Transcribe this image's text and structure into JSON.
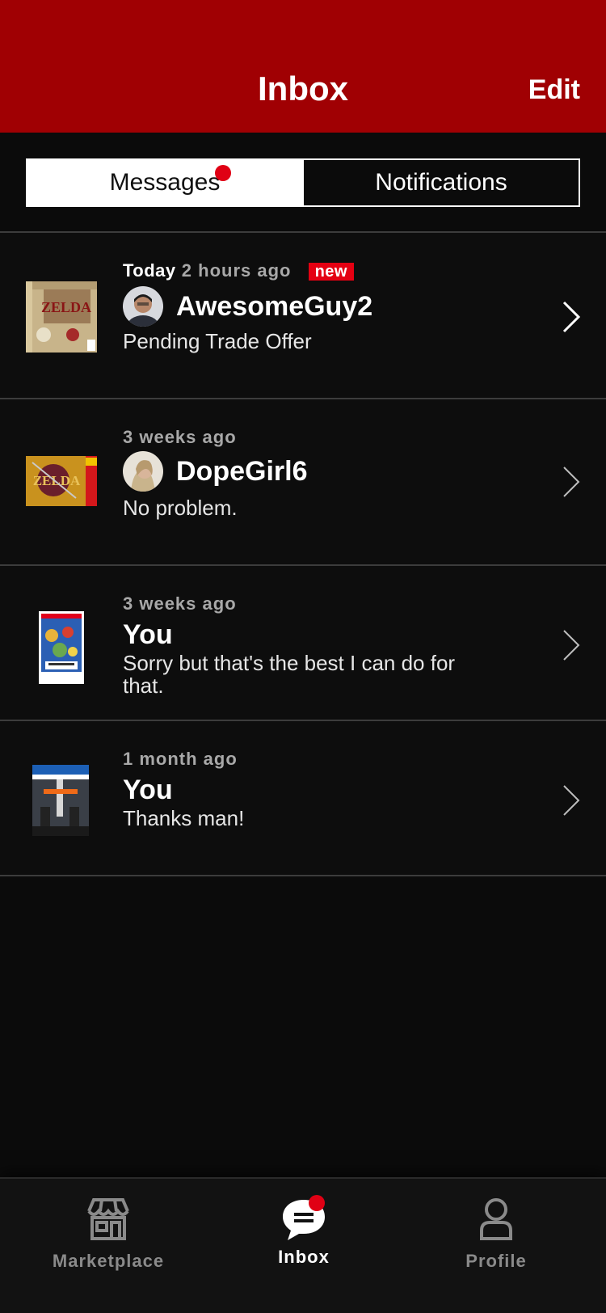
{
  "header": {
    "title": "Inbox",
    "edit_label": "Edit"
  },
  "segmented": {
    "messages_label": "Messages",
    "notifications_label": "Notifications"
  },
  "messages": [
    {
      "today": "Today",
      "time": "2 hours ago",
      "badge": "new",
      "name": "AwesomeGuy2",
      "preview": "Pending Trade Offer",
      "thumb_icon": "zelda-majoras-mask-box-icon",
      "avatar_icon": "user-avatar-icon"
    },
    {
      "time": "3 weeks ago",
      "name": "DopeGirl6",
      "preview": "No problem.",
      "thumb_icon": "zelda-ocarina-box-icon",
      "avatar_icon": "user-avatar-icon"
    },
    {
      "time": "3 weeks ago",
      "name": "You",
      "preview": "Sorry but that's the best I can do for that.",
      "thumb_icon": "smash-bros-box-icon"
    },
    {
      "time": "1 month ago",
      "name": "You",
      "preview": "Thanks man!",
      "thumb_icon": "division-2-box-icon"
    }
  ],
  "tabs": {
    "marketplace_label": "Marketplace",
    "inbox_label": "Inbox",
    "profile_label": "Profile"
  },
  "colors": {
    "brand_red": "#a00003",
    "badge_red": "#e40012",
    "background": "#0b0b0b"
  }
}
